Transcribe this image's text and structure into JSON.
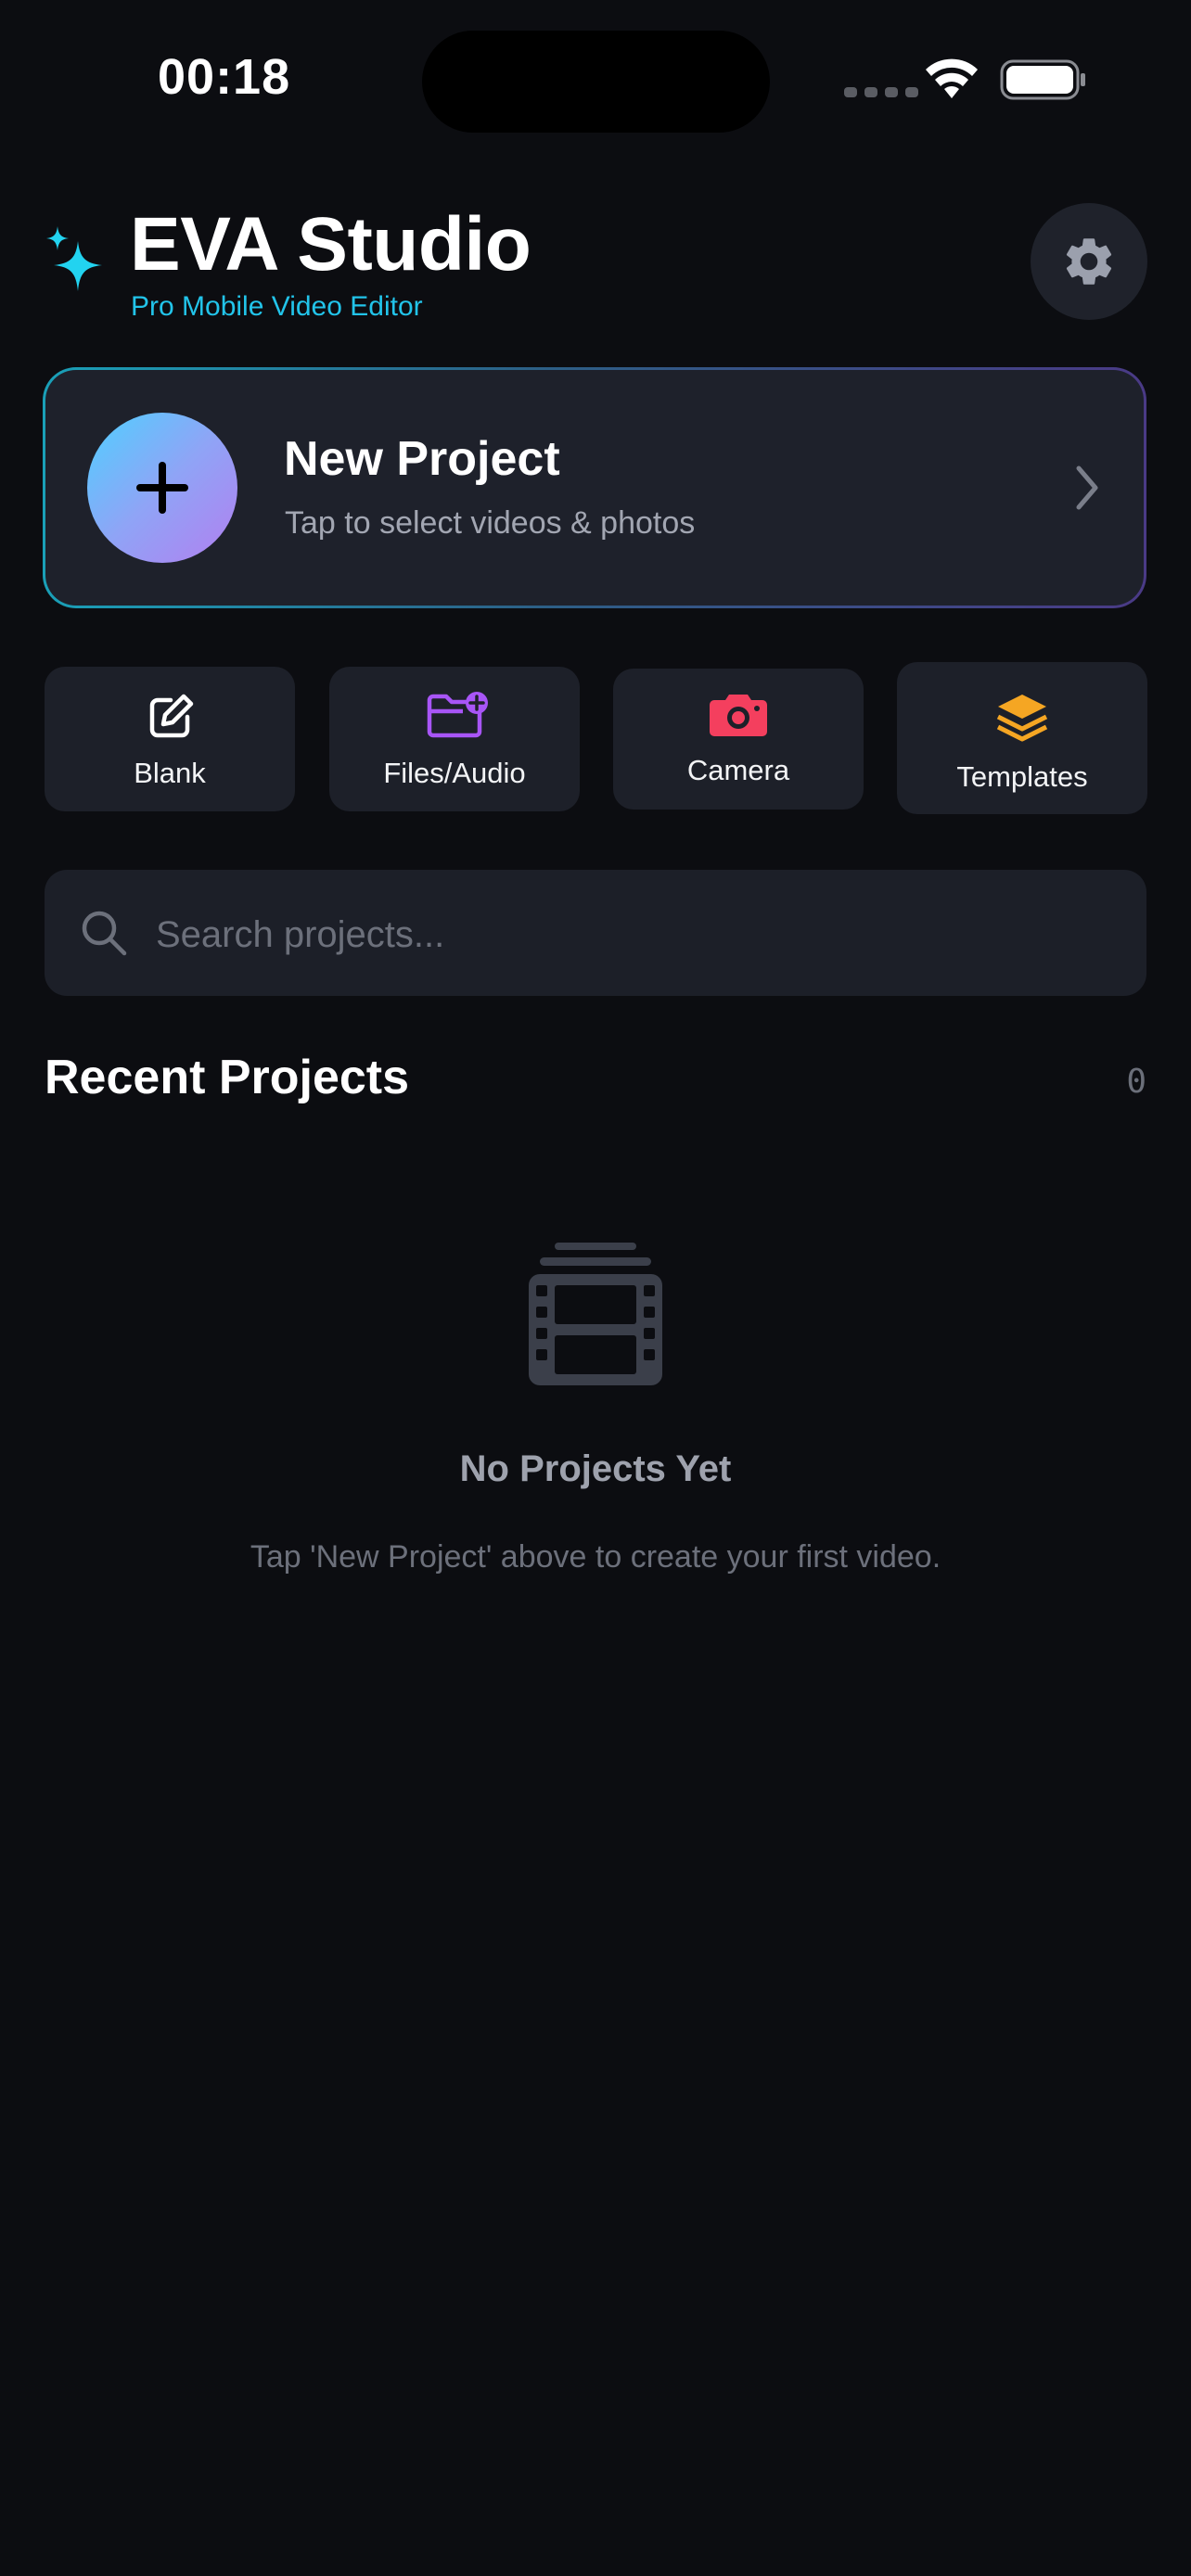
{
  "status_bar": {
    "time": "00:18"
  },
  "header": {
    "title": "EVA Studio",
    "subtitle": "Pro Mobile Video Editor"
  },
  "new_project": {
    "title": "New Project",
    "subtitle": "Tap to select videos & photos"
  },
  "quick_actions": [
    {
      "label": "Blank",
      "icon": "edit-icon",
      "color": "#ffffff"
    },
    {
      "label": "Files/Audio",
      "icon": "folder-plus-icon",
      "color": "#a855f7"
    },
    {
      "label": "Camera",
      "icon": "camera-icon",
      "color": "#f43f5e"
    },
    {
      "label": "Templates",
      "icon": "layers-icon",
      "color": "#f5a623"
    }
  ],
  "search": {
    "placeholder": "Search projects..."
  },
  "recent": {
    "title": "Recent Projects",
    "count": "0"
  },
  "empty_state": {
    "icon": "film-icon",
    "title": "No Projects Yet",
    "description": "Tap 'New Project' above to create your first video."
  },
  "colors": {
    "accent": "#22c4ea",
    "background": "#0c0d11",
    "card": "#1e212b"
  }
}
